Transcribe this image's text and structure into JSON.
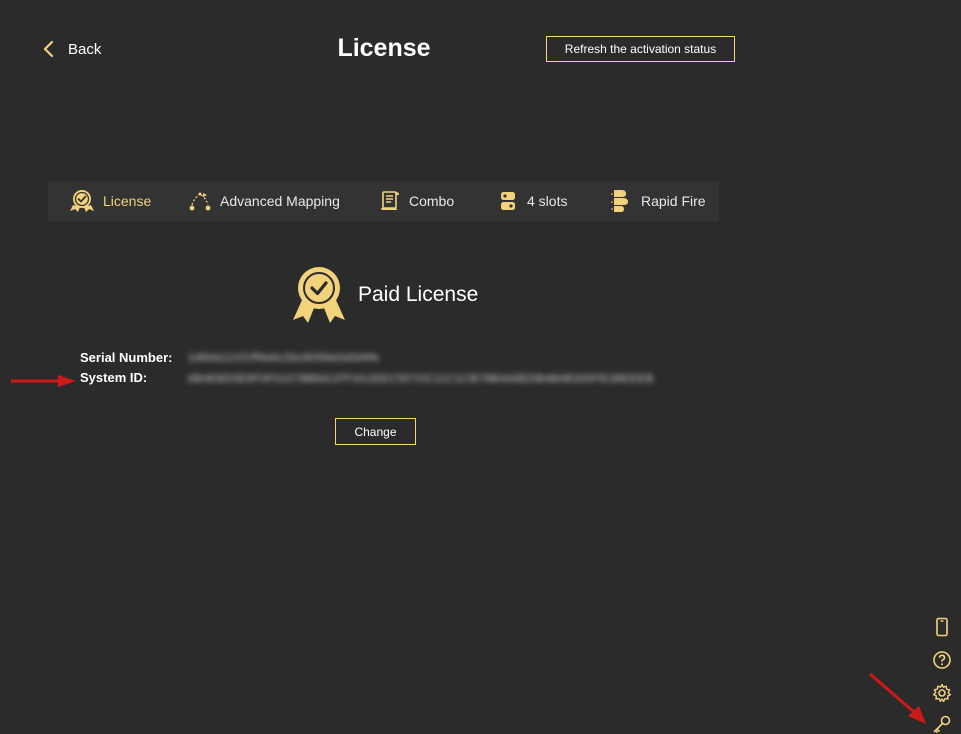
{
  "header": {
    "back_label": "Back",
    "title": "License",
    "refresh_label": "Refresh the activation status"
  },
  "tabs": [
    {
      "label": "License",
      "icon": "badge-check-icon",
      "active": true
    },
    {
      "label": "Advanced Mapping",
      "icon": "mapping-icon",
      "active": false
    },
    {
      "label": "Combo",
      "icon": "scroll-icon",
      "active": false
    },
    {
      "label": "4 slots",
      "icon": "slots-icon",
      "active": false
    },
    {
      "label": "Rapid Fire",
      "icon": "rapid-fire-icon",
      "active": false
    }
  ],
  "license": {
    "type": "Paid License",
    "serial_label": "Serial Number:",
    "serial_value": "1d6da121f1ff9e6c2bc8056e0a5d4fe",
    "system_label": "System ID:",
    "system_value": "6B4E8D0E9F0F0107BB6A1FF4A1EEC557OC11C1CB78B4A8EDB4B4B305FE2BEEEB",
    "change_label": "Change"
  },
  "side_icons": [
    "phone-icon",
    "help-icon",
    "settings-icon",
    "key-icon"
  ],
  "colors": {
    "background": "#2b2b2b",
    "tabbar": "#333333",
    "accent": "#f2d27a",
    "annotation_arrow": "#cc1a1a"
  }
}
